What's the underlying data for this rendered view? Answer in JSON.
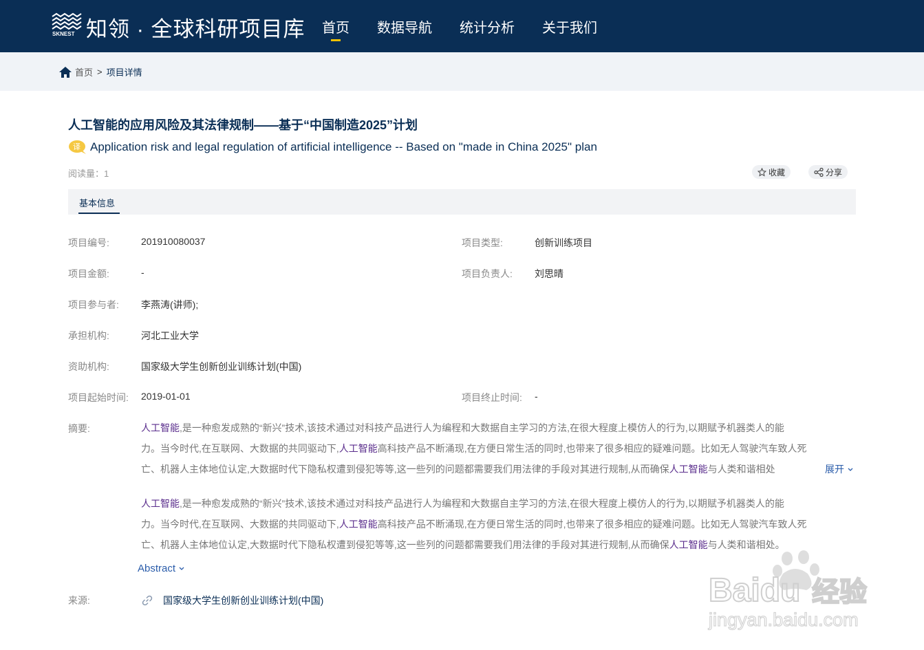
{
  "header": {
    "logo_text": "SKNEST",
    "site_title": "知领 · 全球科研项目库",
    "nav": [
      {
        "label": "首页",
        "active": true
      },
      {
        "label": "数据导航",
        "active": false
      },
      {
        "label": "统计分析",
        "active": false
      },
      {
        "label": "关于我们",
        "active": false
      }
    ],
    "active_color": "#f2c200",
    "bg_color": "#0a2e55"
  },
  "breadcrumb": {
    "home": "首页",
    "separator": ">",
    "current": "项目详情"
  },
  "project": {
    "title_cn": "人工智能的应用风险及其法律规制——基于“中国制造2025”计划",
    "translate_badge": "译",
    "title_en": "Application risk and legal regulation of artificial intelligence -- Based on \"made in China 2025\" plan",
    "reads_label": "阅读量：",
    "reads_value": "1",
    "favorite_label": "收藏",
    "share_label": "分享"
  },
  "tabs": [
    {
      "label": "基本信息",
      "active": true
    }
  ],
  "fields": {
    "project_no": {
      "label": "项目编号:",
      "value": "201910080037"
    },
    "project_type": {
      "label": "项目类型:",
      "value": "创新训练项目"
    },
    "amount": {
      "label": "项目金额:",
      "value": "-"
    },
    "leader": {
      "label": "项目负责人:",
      "value": "刘思晴"
    },
    "participants": {
      "label": "项目参与者:",
      "value": "李燕涛(讲师);"
    },
    "institution": {
      "label": "承担机构:",
      "value": "河北工业大学"
    },
    "funder": {
      "label": "资助机构:",
      "value": "国家级大学生创新创业训练计划(中国)"
    },
    "start": {
      "label": "项目起始时间:",
      "value": "2019-01-01"
    },
    "end": {
      "label": "项目终止时间:",
      "value": "-"
    },
    "abstract_label": "摘要:",
    "source": {
      "label": "来源:",
      "value": "国家级大学生创新创业训练计划(中国)"
    }
  },
  "abstract": {
    "keyword": "人工智能",
    "line1_rest": ",是一种愈发成熟的“新兴”技术,该技术通过对科技产品进行人为编程和大数据自主学习的方法,在很大程度上模仿人的行为,以期赋予机器类人的能",
    "line2_a": "力。当今时代,在互联网、大数据的共同驱动下,",
    "line2_b": "高科技产品不断涌现,在方便日常生活的同时,也带来了很多相应的疑难问题。比如无人驾驶汽车致人死",
    "line3_a": "亡、机器人主体地位认定,大数据时代下隐私权遭到侵犯等等,这一些列的问题都需要我们用法律的手段对其进行规制,从而确保",
    "line3_b_trunc": "与人类和谐相处",
    "line3_b_full": "与人类和谐相处。",
    "expand_label": "展开",
    "abstract_toggle": "Abstract"
  },
  "watermark": {
    "brand": "Baidu",
    "brand_cn": "经验",
    "url": "jingyan.baidu.com"
  }
}
